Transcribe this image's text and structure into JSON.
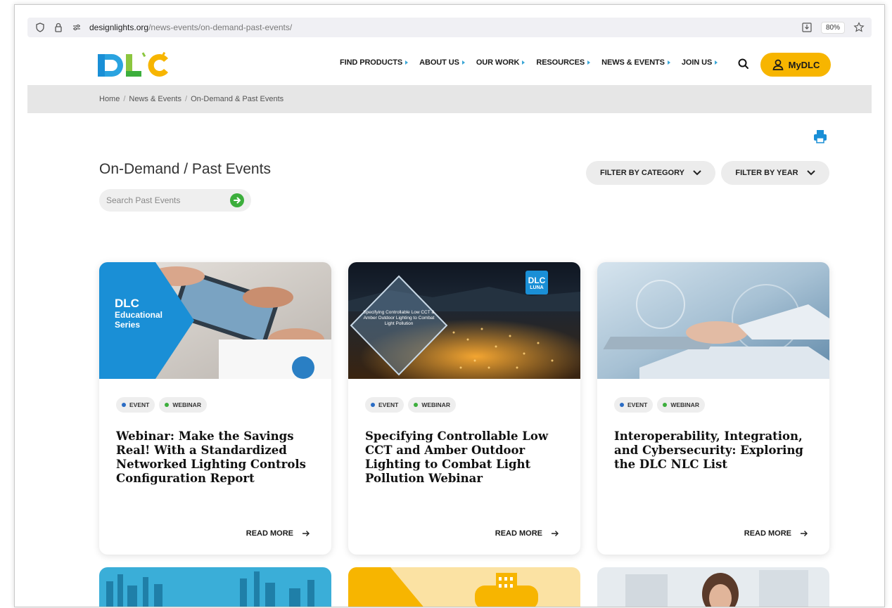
{
  "browser": {
    "url_host": "designlights.org",
    "url_path": "/news-events/on-demand-past-events/",
    "zoom": "80%"
  },
  "header": {
    "logo_text": "DLC",
    "nav": [
      {
        "label": "FIND PRODUCTS"
      },
      {
        "label": "ABOUT US"
      },
      {
        "label": "OUR WORK"
      },
      {
        "label": "RESOURCES"
      },
      {
        "label": "NEWS & EVENTS"
      },
      {
        "label": "JOIN US"
      }
    ],
    "mydlc_label": "MyDLC"
  },
  "breadcrumb": {
    "items": [
      "Home",
      "News & Events",
      "On-Demand & Past Events"
    ],
    "separator": "/"
  },
  "main": {
    "title": "On-Demand / Past Events",
    "search_placeholder": "Search Past Events",
    "filter_category": "FILTER BY CATEGORY",
    "filter_year": "FILTER BY YEAR"
  },
  "cards": [
    {
      "image_overlay": {
        "line1": "DLC",
        "line2": "Educational",
        "line3": "Series"
      },
      "tags": [
        {
          "label": "EVENT",
          "color": "#2a6cc4"
        },
        {
          "label": "WEBINAR",
          "color": "#3cae3c"
        }
      ],
      "title": "Webinar: Make the Savings Real! With a Standardized Networked Lighting Controls Configuration Report",
      "read_more": "READ MORE"
    },
    {
      "image_overlay": {
        "badge_line1": "DLC",
        "badge_line2": "LUNA",
        "diamond_text": "Specifying Controllable Low CCT & Amber Outdoor Lighting to Combat Light Pollution"
      },
      "tags": [
        {
          "label": "EVENT",
          "color": "#2a6cc4"
        },
        {
          "label": "WEBINAR",
          "color": "#3cae3c"
        }
      ],
      "title": "Specifying Controllable Low CCT and Amber Outdoor Lighting to Combat Light Pollution Webinar",
      "read_more": "READ MORE"
    },
    {
      "tags": [
        {
          "label": "EVENT",
          "color": "#2a6cc4"
        },
        {
          "label": "WEBINAR",
          "color": "#3cae3c"
        }
      ],
      "title": "Interoperability, Integration, and Cybersecurity: Exploring the DLC NLC List",
      "read_more": "READ MORE"
    }
  ],
  "colors": {
    "accent_yellow": "#f7b500",
    "accent_blue": "#1a8fd6",
    "accent_green": "#3cae3c"
  }
}
